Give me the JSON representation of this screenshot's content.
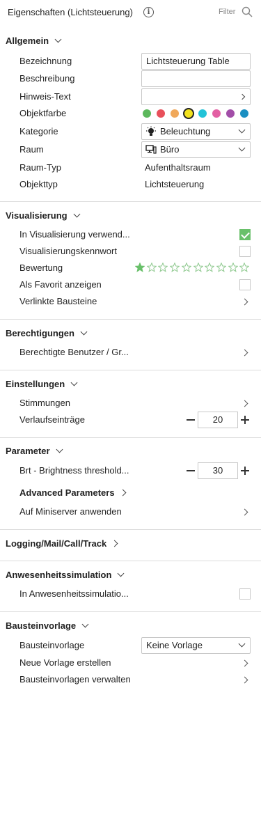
{
  "header": {
    "title": "Eigenschaften (Lichtsteuerung)",
    "filter_label": "Filter"
  },
  "sections": {
    "allgemein": {
      "title": "Allgemein",
      "bezeichnung": {
        "label": "Bezeichnung",
        "value": "Lichtsteuerung Table"
      },
      "beschreibung": {
        "label": "Beschreibung",
        "value": ""
      },
      "hinweis": {
        "label": "Hinweis-Text"
      },
      "objektfarbe": {
        "label": "Objektfarbe",
        "colors": [
          "#5cb85c",
          "#e8505b",
          "#f0a85a",
          "#f2e21e",
          "#22c3d8",
          "#e35fa3",
          "#a24ea8",
          "#1a8fc2"
        ],
        "selected_index": 3
      },
      "kategorie": {
        "label": "Kategorie",
        "value": "Beleuchtung",
        "icon": "lightbulb-icon"
      },
      "raum": {
        "label": "Raum",
        "value": "Büro",
        "icon": "workstation-icon"
      },
      "raum_typ": {
        "label": "Raum-Typ",
        "value": "Aufenthaltsraum"
      },
      "objekttyp": {
        "label": "Objekttyp",
        "value": "Lichtsteuerung"
      }
    },
    "visualisierung": {
      "title": "Visualisierung",
      "in_visualisierung": {
        "label": "In Visualisierung verwend...",
        "checked": true
      },
      "kennwort": {
        "label": "Visualisierungskennwort",
        "checked": false
      },
      "bewertung": {
        "label": "Bewertung",
        "rating": 1,
        "max": 10
      },
      "favorit": {
        "label": "Als Favorit anzeigen",
        "checked": false
      },
      "verlinkte": {
        "label": "Verlinkte Bausteine"
      }
    },
    "berechtigungen": {
      "title": "Berechtigungen",
      "benutzer": {
        "label": "Berechtigte Benutzer / Gr..."
      }
    },
    "einstellungen": {
      "title": "Einstellungen",
      "stimmungen": {
        "label": "Stimmungen"
      },
      "verlauf": {
        "label": "Verlaufseinträge",
        "value": "20"
      }
    },
    "parameter": {
      "title": "Parameter",
      "brt": {
        "label": "Brt - Brightness threshold...",
        "value": "30"
      },
      "advanced": {
        "label": "Advanced Parameters"
      },
      "miniserver": {
        "label": "Auf Miniserver anwenden"
      }
    },
    "logging": {
      "title": "Logging/Mail/Call/Track"
    },
    "anwesenheit": {
      "title": "Anwesenheitssimulation",
      "in_anwesenheit": {
        "label": "In Anwesenheitssimulatio...",
        "checked": false
      }
    },
    "bausteinvorlage": {
      "title": "Bausteinvorlage",
      "vorlage": {
        "label": "Bausteinvorlage",
        "value": "Keine Vorlage"
      },
      "neue": {
        "label": "Neue Vorlage erstellen"
      },
      "verwalten": {
        "label": "Bausteinvorlagen verwalten"
      }
    }
  },
  "colors": {
    "accent_green": "#69c06a",
    "divider": "#dcdcdc",
    "text": "#222222"
  }
}
